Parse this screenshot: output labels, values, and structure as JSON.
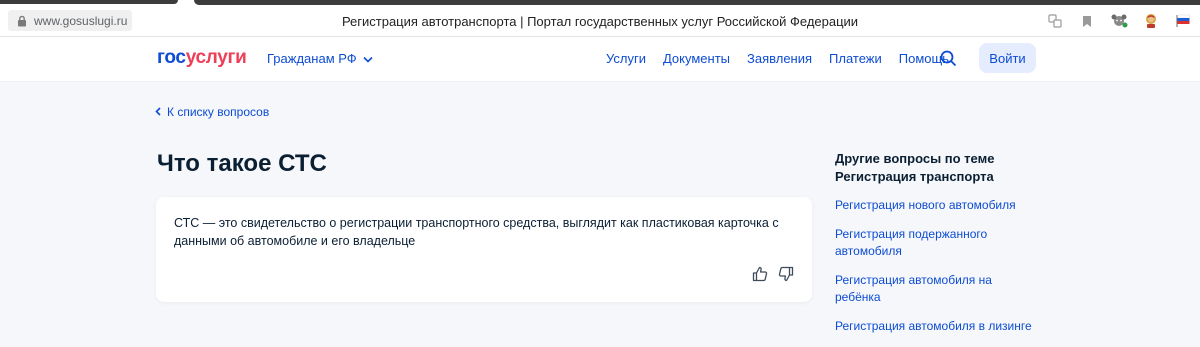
{
  "browser": {
    "url": "www.gosuslugi.ru",
    "tab_title": "Регистрация автотранспорта | Портал государственных услуг Российской Федерации",
    "icons": [
      "lock-icon",
      "translate-icon",
      "bookmark-icon",
      "extension-icon",
      "avatar-extension-icon",
      "flag-ru-icon"
    ]
  },
  "header": {
    "logo_part1": "гос",
    "logo_part2": "услуги",
    "citizens_label": "Гражданам РФ",
    "nav": [
      "Услуги",
      "Документы",
      "Заявления",
      "Платежи",
      "Помощь"
    ],
    "login_label": "Войти"
  },
  "main": {
    "back_link": "К списку вопросов",
    "title": "Что такое СТС",
    "answer": "СТС — это свидетельство о регистрации транспортного средства, выглядит как пластиковая карточка с данными об автомобиле и его владельце"
  },
  "sidebar": {
    "title": "Другие вопросы по теме Регистрация транспорта",
    "links": [
      "Регистрация нового автомобиля",
      "Регистрация подержанного автомобиля",
      "Регистрация автомобиля на ребёнка",
      "Регистрация автомобиля в лизинге"
    ]
  },
  "colors": {
    "brand_blue": "#0d4cd3",
    "brand_red": "#ee3f58",
    "page_bg": "#f5f7fa",
    "text": "#0b1f33"
  }
}
